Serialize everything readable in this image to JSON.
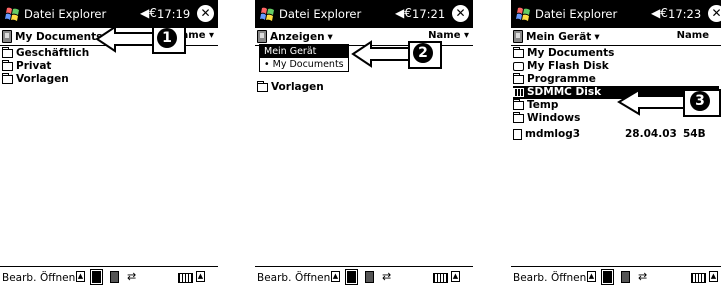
{
  "screens": [
    {
      "title": "Datei Explorer",
      "clock": "17:19",
      "folder_label": "My Documents",
      "sort_label": "Name",
      "files": [
        {
          "name": "Geschäftlich",
          "icon": "folder-icon"
        },
        {
          "name": "Privat",
          "icon": "folder-icon"
        },
        {
          "name": "Vorlagen",
          "icon": "folder-icon"
        }
      ],
      "callout_number": "1"
    },
    {
      "title": "Datei Explorer",
      "clock": "17:21",
      "folder_label": "Anzeigen",
      "sort_label": "Name",
      "menu_items": [
        "Mein Gerät",
        "• My Documents"
      ],
      "files": [
        {
          "name": "Vorlagen",
          "icon": "folder-icon"
        }
      ],
      "callout_number": "2"
    },
    {
      "title": "Datei Explorer",
      "clock": "17:23",
      "folder_label": "Mein Gerät",
      "sort_label": "Name",
      "files": [
        {
          "name": "My Documents",
          "icon": "folder-icon"
        },
        {
          "name": "My Flash Disk",
          "icon": "flash-disk-icon"
        },
        {
          "name": "Programme",
          "icon": "folder-icon"
        },
        {
          "name": "SDMMC Disk",
          "icon": "storage-card-icon",
          "selected": true
        },
        {
          "name": "Temp",
          "icon": "folder-icon"
        },
        {
          "name": "Windows",
          "icon": "folder-icon"
        },
        {
          "name": "mdmlog3",
          "icon": "document-icon",
          "date": "28.04.03",
          "size": "54B"
        }
      ],
      "callout_number": "3"
    }
  ],
  "command_bar": {
    "edit_label": "Bearb.",
    "open_label": "Öffnen",
    "up_arrow": "▲"
  },
  "glyphs": {
    "speaker": "◀€",
    "close": "✕",
    "dropdown": "▾"
  }
}
